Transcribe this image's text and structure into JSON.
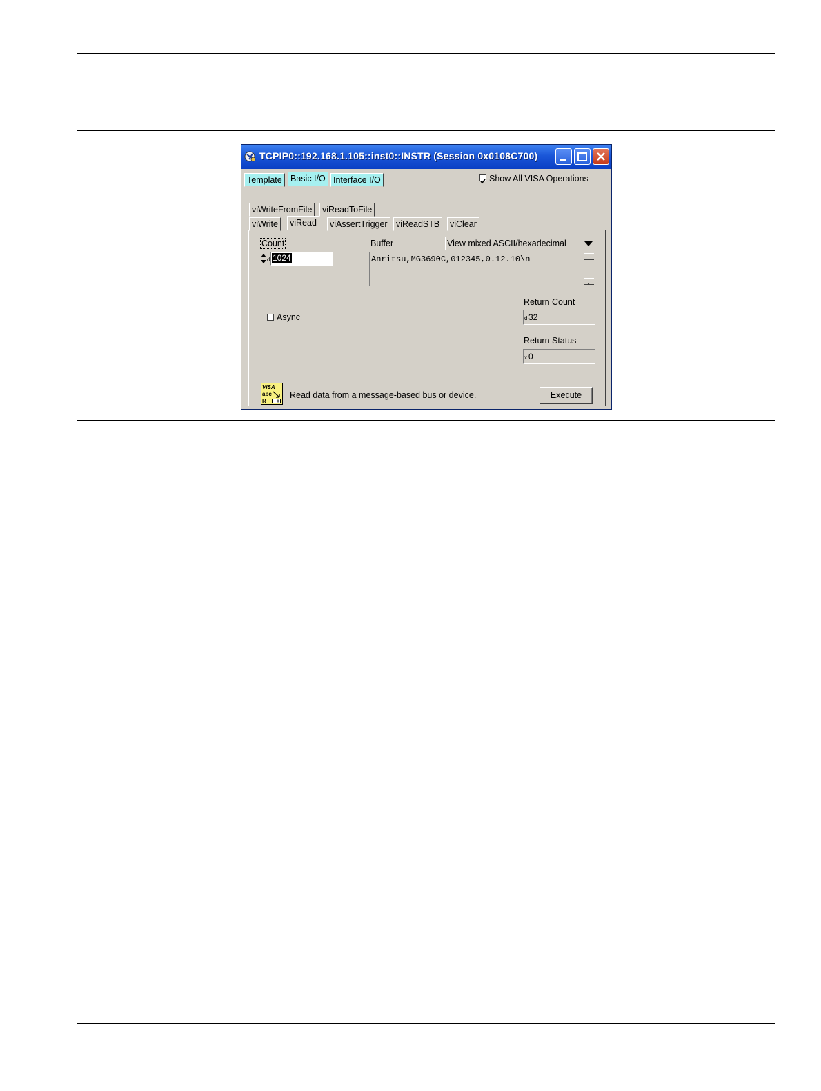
{
  "window": {
    "title": "TCPIP0::192.168.1.105::inst0::INSTR (Session 0x0108C700)",
    "minimize_label": "_"
  },
  "tabs_main": [
    {
      "label": "Template"
    },
    {
      "label": "Basic I/O"
    },
    {
      "label": "Interface I/O"
    }
  ],
  "show_all": {
    "label": "Show All VISA Operations",
    "checked": true
  },
  "tabs_sub_row1": [
    {
      "label": "viWriteFromFile"
    },
    {
      "label": "viReadToFile"
    }
  ],
  "tabs_sub_row2": [
    {
      "label": "viWrite"
    },
    {
      "label": "viRead"
    },
    {
      "label": "viAssertTrigger"
    },
    {
      "label": "viReadSTB"
    },
    {
      "label": "viClear"
    }
  ],
  "count": {
    "label": "Count",
    "value": "1024",
    "radix": "d"
  },
  "buffer": {
    "label": "Buffer",
    "view_mode": "View mixed ASCII/hexadecimal",
    "content": "Anritsu,MG3690C,012345,0.12.10\\n"
  },
  "async": {
    "label": "Async",
    "checked": false
  },
  "return_count": {
    "label": "Return Count",
    "value": "32",
    "radix": "d"
  },
  "return_status": {
    "label": "Return Status",
    "value": "0",
    "radix": "x"
  },
  "visa_icon": {
    "line1": "VISA",
    "line2": "abc",
    "line3": "R"
  },
  "description": "Read data from a message-based bus or device.",
  "execute_label": "Execute"
}
